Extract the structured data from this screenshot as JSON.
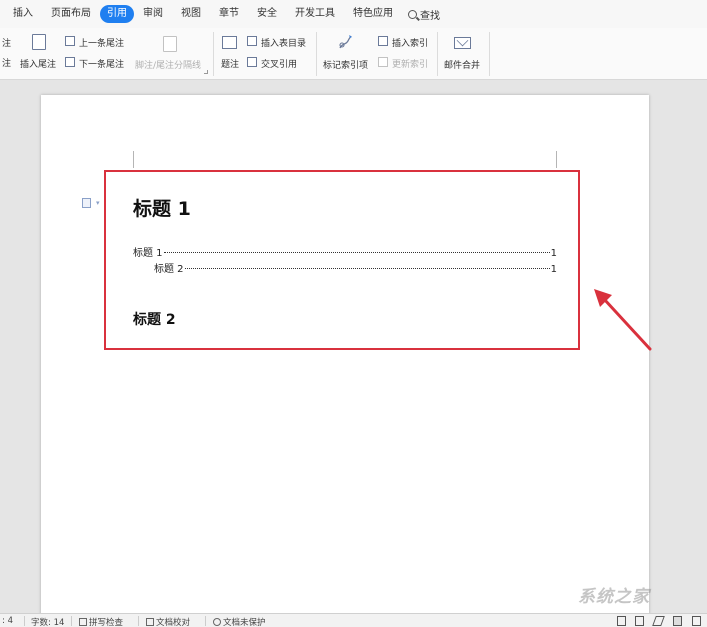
{
  "menu": {
    "items": [
      "插入",
      "页面布局",
      "引用",
      "审阅",
      "视图",
      "章节",
      "安全",
      "开发工具",
      "特色应用"
    ],
    "active": "引用",
    "search": "查找"
  },
  "ribbon": {
    "edge_top": "注",
    "edge_bottom": "注",
    "insert_endnote": "插入尾注",
    "prev_endnote": "上一条尾注",
    "next_endnote": "下一条尾注",
    "separator_line": "脚注/尾注分隔线",
    "caption": "题注",
    "insert_table_of_figures": "插入表目录",
    "cross_reference": "交叉引用",
    "mark_index_entry": "标记索引项",
    "insert_index": "插入索引",
    "update_index": "更新索引",
    "mail_merge": "邮件合并"
  },
  "document": {
    "heading1": "标题 1",
    "toc": [
      {
        "text": "标题 1",
        "page": "1"
      },
      {
        "text": "标题 2",
        "page": "1"
      }
    ],
    "heading2": "标题 2"
  },
  "statusbar": {
    "page_fragment": ": 4",
    "word_count": "字数: 14",
    "spell_check": "拼写检查",
    "doc_proofread": "文档校对",
    "doc_unprotected": "文档未保护"
  },
  "watermark": "系统之家",
  "colors": {
    "accent": "#1f7ff0",
    "highlight_box": "#d9313d",
    "arrow": "#d9313d"
  }
}
